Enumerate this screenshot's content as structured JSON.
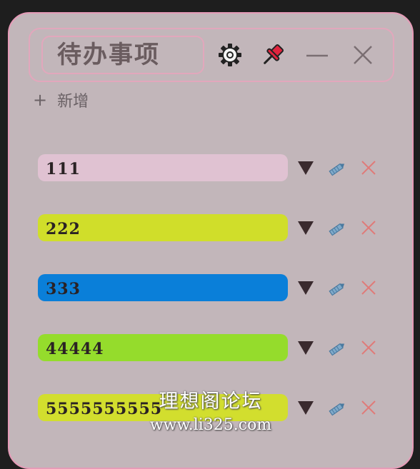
{
  "header": {
    "title": "待办事项"
  },
  "toolbar": {
    "gear_icon": "gear-icon",
    "pin_icon": "pushpin-icon",
    "minimize_icon": "minimize-icon",
    "close_icon": "close-icon"
  },
  "add": {
    "plus": "+",
    "label": "新增"
  },
  "todos": [
    {
      "text": "111",
      "color": "#e0c2d2"
    },
    {
      "text": "222",
      "color": "#d0de2a"
    },
    {
      "text": "333",
      "color": "#0a7fd9"
    },
    {
      "text": "44444",
      "color": "#95dc2c"
    },
    {
      "text": "5555555555",
      "color": "#d2de2e"
    }
  ],
  "colors": {
    "window_bg": "#c2b6ba",
    "border": "#e59bb7",
    "dropdown": "#3a2a2e",
    "edit": "#5a8bb0",
    "delete": "#e07a78",
    "pin": "#e0243e"
  },
  "watermark": {
    "line1": "理想阁论坛",
    "line2": "www.li325.com"
  }
}
